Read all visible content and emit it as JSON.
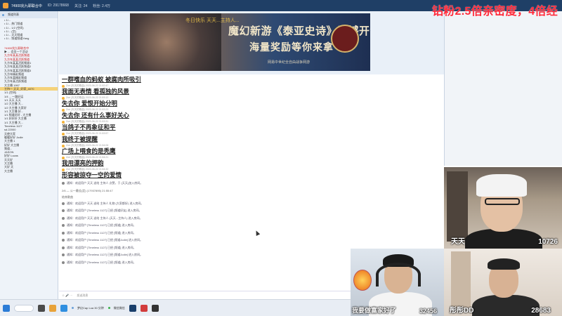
{
  "window": {
    "title": "74900兆九耶联合中",
    "id_text": "ID: 29178668",
    "stats": [
      "关注: 24",
      "粉丝: 2.4万"
    ],
    "overlay_text": "钻粉2.5倍亲密度，4倍经"
  },
  "sidebar": {
    "header": "频道列表",
    "rows": [
      {
        "label": "• 1/...",
        "style": "normal"
      },
      {
        "label": "• 1/...  热门频道",
        "style": "normal"
      },
      {
        "label": "• 1/...  1/2 (空间)",
        "style": "normal"
      },
      {
        "label": "• 1/...  (空)",
        "style": "normal"
      },
      {
        "label": "• 1/...  天天频道",
        "style": "normal"
      },
      {
        "label": "• 1/...  频道频道Yang",
        "style": "normal"
      },
      {
        "label": "",
        "style": "sep"
      },
      {
        "label": "74900兆九耶联合中",
        "style": "red"
      },
      {
        "label": "  ▶ ...  会员一个活动",
        "style": "normal"
      },
      {
        "label": "九方年某某活跃频道",
        "style": "red"
      },
      {
        "label": "九方年某某活跃频道",
        "style": "red"
      },
      {
        "label": "九方年某某活跃频道1",
        "style": "normal"
      },
      {
        "label": "九方年某某活跃频道2",
        "style": "normal"
      },
      {
        "label": "九方年某某活跃频道3",
        "style": "normal"
      },
      {
        "label": "九方年精彩频道",
        "style": "normal"
      },
      {
        "label": "九方年某精彩频道",
        "style": "normal"
      },
      {
        "label": "九方年某活跃频道",
        "style": "normal"
      },
      {
        "label": "大主播 1997",
        "style": "normal"
      },
      {
        "label": "主持一 天天_好家_4070",
        "style": "sel"
      },
      {
        "label": "1/1 (空间)",
        "style": "normal"
      },
      {
        "label": "1/4 ... 一路好运",
        "style": "normal"
      },
      {
        "label": "1/1 天天 天天",
        "style": "normal"
      },
      {
        "label": "1/2 大主播 大...",
        "style": "normal"
      },
      {
        "label": "1/2 大主播 大家好",
        "style": "normal"
      },
      {
        "label": "1/1 大主播 好...",
        "style": "normal"
      },
      {
        "label": "1/1 频道好好 - 大主播",
        "style": "normal"
      },
      {
        "label": "1/1 好好好 大主播",
        "style": "normal"
      },
      {
        "label": "1/1 大主播 大...",
        "style": "normal"
      },
      {
        "label": "Timeless 1127",
        "style": "normal"
      },
      {
        "label": "sd.22000",
        "style": "normal"
      },
      {
        "label": "天使大家",
        "style": "normal"
      },
      {
        "label": "暖暖好好 Jodie",
        "style": "normal"
      },
      {
        "label": "大主播 1",
        "style": "normal"
      },
      {
        "label": "好好 大主播",
        "style": "normal"
      },
      {
        "label": "频道...",
        "style": "normal"
      },
      {
        "label": "JASON",
        "style": "normal"
      },
      {
        "label": "好好 Lucas",
        "style": "normal"
      },
      {
        "label": "天天好",
        "style": "normal"
      },
      {
        "label": "大主播",
        "style": "normal"
      },
      {
        "label": "大好 天",
        "style": "normal"
      },
      {
        "label": "大主播",
        "style": "normal"
      }
    ]
  },
  "banner": {
    "line1": "魔幻新游《泰亚史诗》震撼开测",
    "line2": "海量奖励等你来拿",
    "line3": "网易中世纪全自由战争网游",
    "overlay": "冬日快乐 天天...主持人..."
  },
  "chat": {
    "messages": [
      {
        "meta": "",
        "text": "一群嗜血的蚂蚁 被腐肉所吸引"
      },
      {
        "meta": "Zoe  (天天的歌曲) 2023-06-22 21:52:47",
        "text": "我面无表情 看孤独的风景"
      },
      {
        "meta": "Zoe  (天天的歌曲) 2023-06-22 21:53:12",
        "text": "失去你 爱恨开始分明"
      },
      {
        "meta": "Zoe  (天天的歌曲) 2023-06-22 21:53:23",
        "text": "失去你 还有什么事好关心"
      },
      {
        "meta": "Zoe  (天天的歌曲) 2023-06-22 21:53:31",
        "text": "当鸽子不再象征和平"
      },
      {
        "meta": "Zoe  (天天的歌曲) 2023-06-22 21:53:57",
        "text": "我终于被提醒"
      },
      {
        "meta": "Zoe  (天天的歌曲) 2023-06-22 21:54:06",
        "text": "广场上喂食的是秃鹰"
      },
      {
        "meta": "Zoe  (天天的歌曲) 2023-06-22 21:54:21",
        "text": "我用漂亮的押韵"
      },
      {
        "meta": "Zoe  (天天的歌曲) 2023-06-22 21:54:32",
        "text": "形容被掠夺一空的爱情"
      }
    ],
    "system": [
      "通知：欢迎用户 天天 送给 主持人 点赞，于 (天天)加入房间。",
      "2/6 — 公一最佳(定) (17937895)  21:55:47",
      "结束歌曲",
      "通知：欢迎用户 天天 送给 主持人 礼物 (大家都好) 进入房间。",
      "通知：欢迎用户 [Timeless 1127] 已经 [频道好友] 进入房间。",
      "通知：欢迎用户 天天 送给 主持人 (天天...主持人) 进入房间。",
      "通知：欢迎用户 [Timeless 1127] 已经 [频道] 进入房间。",
      "通知：欢迎用户 [Timeless 1127] 已经 [频道] 进入房间。",
      "通知：欢迎用户 [Timeless 1127] 已经 [频道Jodie] 进入房间。",
      "通知：欢迎用户 [Timeless 1127] 已经 [频道] 进入房间。",
      "通知：欢迎用户 [Timeless 1127] 已经 [频道Jodie] 进入房间。",
      "通知：欢迎用户 [Timeless 1127] 已经 [频道] 进入房间。"
    ],
    "input_icons": "☺ 🎤 ···",
    "input_placeholder": "发送消息"
  },
  "webcams": {
    "cam1": {
      "name": "天天",
      "count": "10726"
    },
    "cam2": {
      "name": "我要做富家好了",
      "count": "32456"
    },
    "cam3": {
      "name": "彤彤DD",
      "count": "28683"
    }
  },
  "taskbar": {
    "notification": "梦幻Cap Lua 30 分钟",
    "other": "微信微信"
  }
}
